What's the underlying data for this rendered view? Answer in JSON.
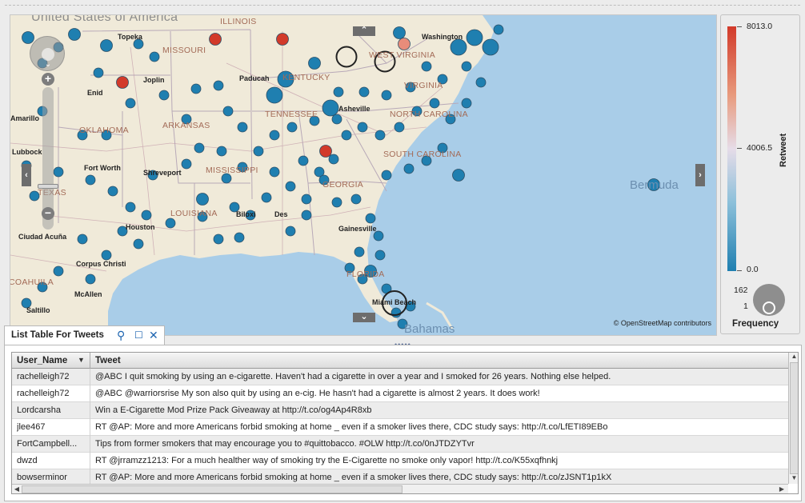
{
  "map": {
    "state_labels": [
      {
        "id": "illinois",
        "text": "ILLINOIS"
      },
      {
        "id": "missouri",
        "text": "MISSOURI"
      },
      {
        "id": "kentucky",
        "text": "KENTUCKY"
      },
      {
        "id": "west-virginia",
        "text": "WEST VIRGINIA"
      },
      {
        "id": "virginia",
        "text": "VIRGINIA"
      },
      {
        "id": "oklahoma",
        "text": "OKLAHOMA"
      },
      {
        "id": "arkansas",
        "text": "ARKANSAS"
      },
      {
        "id": "tennessee",
        "text": "TENNESSEE"
      },
      {
        "id": "north-carolina",
        "text": "NORTH CAROLINA"
      },
      {
        "id": "south-carolina",
        "text": "SOUTH CAROLINA"
      },
      {
        "id": "mississippi",
        "text": "MISSISSIPPI"
      },
      {
        "id": "georgia",
        "text": "GEORGIA"
      },
      {
        "id": "texas",
        "text": "TEXAS"
      },
      {
        "id": "louisiana",
        "text": "LOUISIANA"
      },
      {
        "id": "florida",
        "text": "FLORIDA"
      },
      {
        "id": "coahuila",
        "text": "COAHUILA"
      }
    ],
    "city_labels": [
      {
        "id": "topeka",
        "text": "Topeka"
      },
      {
        "id": "joplin",
        "text": "Joplin"
      },
      {
        "id": "enid",
        "text": "Enid"
      },
      {
        "id": "amarillo",
        "text": "Amarillo"
      },
      {
        "id": "lubbock",
        "text": "Lubbock"
      },
      {
        "id": "fort-worth",
        "text": "Fort Worth"
      },
      {
        "id": "shreveport",
        "text": "Shreveport"
      },
      {
        "id": "paducah",
        "text": "Paducah"
      },
      {
        "id": "asheville",
        "text": "Asheville"
      },
      {
        "id": "biloxi",
        "text": "Biloxi"
      },
      {
        "id": "des",
        "text": "Des"
      },
      {
        "id": "gainesville",
        "text": "Gainesville"
      },
      {
        "id": "houston",
        "text": "Houston"
      },
      {
        "id": "corpus-christi",
        "text": "Corpus Christi"
      },
      {
        "id": "ciudad-acuna",
        "text": "Ciudad Acuña"
      },
      {
        "id": "mcallen",
        "text": "McAllen"
      },
      {
        "id": "saltillo",
        "text": "Saltillo"
      },
      {
        "id": "washington",
        "text": "Washington"
      },
      {
        "id": "miami-beach",
        "text": "Miami Beach"
      }
    ],
    "region_labels": [
      {
        "id": "united-states",
        "text": "United States of America"
      },
      {
        "id": "bermuda",
        "text": "Bermuda"
      },
      {
        "id": "bahamas",
        "text": "Bahamas"
      }
    ],
    "attribution": "© OpenStreetMap contributors",
    "zoom_in": "+",
    "zoom_out": "−",
    "colors": {
      "water": "#a9cde8",
      "land": "#f0ead9",
      "low": "#1f7fb0",
      "high": "#d23a2a"
    },
    "marker_values": [
      {
        "v": 0,
        "r": 1
      },
      {
        "v": 0,
        "r": 1
      },
      {
        "v": 8013,
        "r": 1
      },
      {
        "v": 0,
        "r": 1
      },
      {
        "v": 4000,
        "r": 1
      },
      {
        "v": 0,
        "r": 2
      },
      {
        "v": 0,
        "r": 1
      },
      {
        "v": 6000,
        "r": 1
      },
      {
        "v": 0,
        "r": 3
      },
      {
        "v": 0,
        "r": 3
      },
      {
        "v": 0,
        "r": 2
      },
      {
        "v": 0,
        "r": 2
      },
      {
        "v": 0,
        "r": 2
      },
      {
        "v": 0,
        "r": 2
      },
      {
        "v": 0,
        "r": 1
      },
      {
        "v": 7000,
        "r": 1
      },
      {
        "v": 0,
        "r": 2
      },
      {
        "v": 0,
        "r": 1
      },
      {
        "v": 0,
        "r": 1
      },
      {
        "v": 8013,
        "r": 1
      },
      {
        "v": 0,
        "r": 1
      },
      {
        "v": 0,
        "r": 4
      },
      {
        "v": 0,
        "r": 1
      }
    ]
  },
  "legend": {
    "retweet_title": "Retweet",
    "max": "8013.0",
    "mid": "4006.5",
    "min": "0.0",
    "freq_title": "Frequency",
    "freq_max": "162",
    "freq_min": "1"
  },
  "table": {
    "tab_title": "List Table For Tweets",
    "columns": [
      "User_Name",
      "Tweet"
    ],
    "rows": [
      {
        "user": "rachelleigh72",
        "tweet": "@ABC I quit smoking by using an e-cigarette. Haven't had a cigarette in over a year and I smoked for 26 years. Nothing else helped."
      },
      {
        "user": "rachelleigh72",
        "tweet": "@ABC @warriorsrise My son also quit by using an e-cig. He hasn't had a cigarette is almost 2 years. It does work!"
      },
      {
        "user": "Lordcarsha",
        "tweet": "Win a E-Cigarette Mod Prize Pack Giveaway at http://t.co/og4Ap4R8xb"
      },
      {
        "user": "jlee467",
        "tweet": "RT @AP: More and more Americans forbid smoking at home _ even if a smoker lives there, CDC study says: http://t.co/LfETI89EBo"
      },
      {
        "user": "FortCampbell...",
        "tweet": "Tips from former smokers that may encourage you to #quittobacco. #OLW http://t.co/0nJTDZYTvr"
      },
      {
        "user": "dwzd",
        "tweet": "RT @jrramzz1213: For a much healther way of smoking try the E-Cigarette  no smoke only vapor! http://t.co/K55xqfhnkj"
      },
      {
        "user": "bowserminor",
        "tweet": "RT @AP: More and more Americans forbid smoking at home _ even if a smoker lives there, CDC study says: http://t.co/zJSNT1p1kX"
      }
    ]
  }
}
